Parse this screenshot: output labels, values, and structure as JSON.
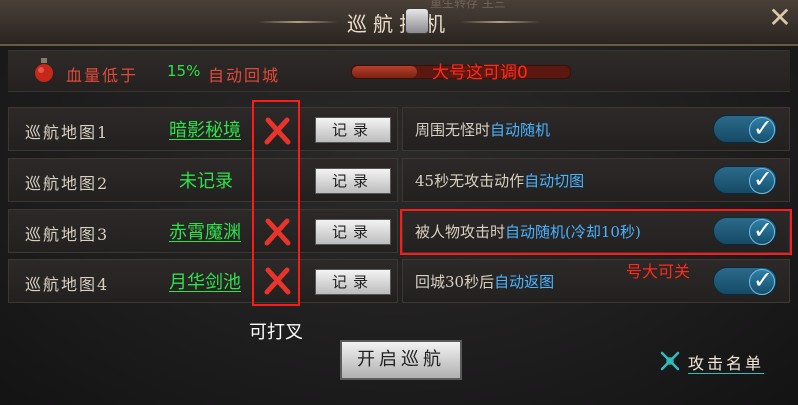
{
  "window": {
    "title": "巡航挂机",
    "top_glimpse": "重生转存 主三",
    "close_label": "✕"
  },
  "hp": {
    "label_prefix": "血量低于",
    "percent": "15%",
    "label_suffix": "自动回城",
    "slider_value_fraction": 0.3
  },
  "maps": [
    {
      "label": "巡航地图1",
      "name": "暗影秘境",
      "record_label": "记录"
    },
    {
      "label": "巡航地图2",
      "name": "未记录",
      "record_label": "记录"
    },
    {
      "label": "巡航地图3",
      "name": "赤霄魔渊",
      "record_label": "记录"
    },
    {
      "label": "巡航地图4",
      "name": "月华剑池",
      "record_label": "记录"
    }
  ],
  "options": [
    {
      "text_a": "周围无怪时",
      "text_b": "自动随机",
      "text_c": "",
      "checked": true
    },
    {
      "text_a": "45秒无攻击动作",
      "text_b": "自动切图",
      "text_c": "",
      "checked": true
    },
    {
      "text_a": "被人物攻击时",
      "text_b": "自动随机",
      "text_c": "(冷却10秒)",
      "checked": true
    },
    {
      "text_a": "回城30秒后",
      "text_b": "自动返图",
      "text_c": "",
      "checked": true
    }
  ],
  "annotations": {
    "slider_note": "大号这可调0",
    "clear_note": "可打叉",
    "toggle_note": "号大可关"
  },
  "footer": {
    "start_label": "开启巡航",
    "attack_list_label": "攻击名单"
  },
  "colors": {
    "accent_green": "#2ee04a",
    "highlight_blue": "#4ab4ff",
    "hp_red": "#e24a3a",
    "annotation_red": "#ff1a1a"
  }
}
